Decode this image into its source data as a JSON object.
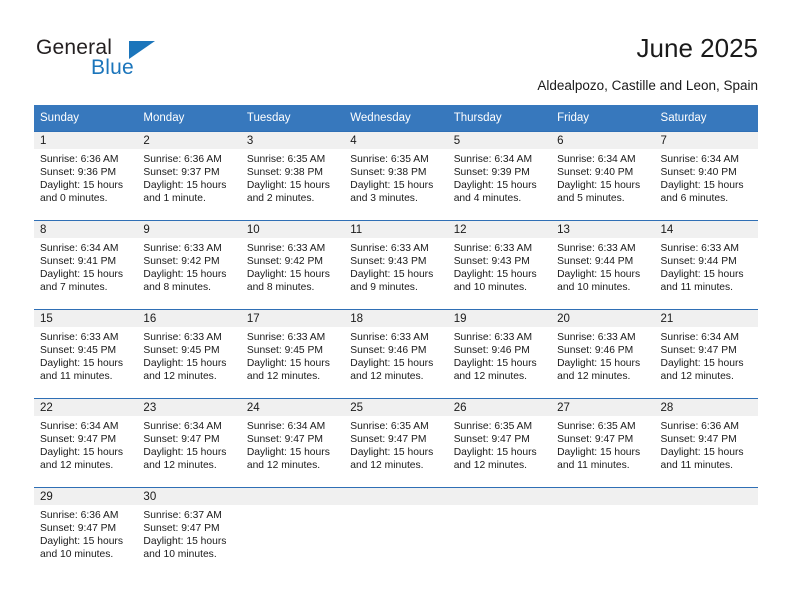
{
  "brand": {
    "name_part1": "General",
    "name_part2": "Blue",
    "accent_color": "#1b75bb",
    "triangle_icon": "triangle-icon"
  },
  "header": {
    "title": "June 2025",
    "location": "Aldealpozo, Castille and Leon, Spain"
  },
  "theme": {
    "header_blue": "#3778bd",
    "row_border_blue": "#2f6fb5",
    "daynum_band": "#f0f0f0",
    "text": "#1a1a1a"
  },
  "weekday_headers": [
    "Sunday",
    "Monday",
    "Tuesday",
    "Wednesday",
    "Thursday",
    "Friday",
    "Saturday"
  ],
  "weeks": [
    [
      {
        "day": "1",
        "sunrise": "Sunrise: 6:36 AM",
        "sunset": "Sunset: 9:36 PM",
        "daylight_line1": "Daylight: 15 hours",
        "daylight_line2": "and 0 minutes."
      },
      {
        "day": "2",
        "sunrise": "Sunrise: 6:36 AM",
        "sunset": "Sunset: 9:37 PM",
        "daylight_line1": "Daylight: 15 hours",
        "daylight_line2": "and 1 minute."
      },
      {
        "day": "3",
        "sunrise": "Sunrise: 6:35 AM",
        "sunset": "Sunset: 9:38 PM",
        "daylight_line1": "Daylight: 15 hours",
        "daylight_line2": "and 2 minutes."
      },
      {
        "day": "4",
        "sunrise": "Sunrise: 6:35 AM",
        "sunset": "Sunset: 9:38 PM",
        "daylight_line1": "Daylight: 15 hours",
        "daylight_line2": "and 3 minutes."
      },
      {
        "day": "5",
        "sunrise": "Sunrise: 6:34 AM",
        "sunset": "Sunset: 9:39 PM",
        "daylight_line1": "Daylight: 15 hours",
        "daylight_line2": "and 4 minutes."
      },
      {
        "day": "6",
        "sunrise": "Sunrise: 6:34 AM",
        "sunset": "Sunset: 9:40 PM",
        "daylight_line1": "Daylight: 15 hours",
        "daylight_line2": "and 5 minutes."
      },
      {
        "day": "7",
        "sunrise": "Sunrise: 6:34 AM",
        "sunset": "Sunset: 9:40 PM",
        "daylight_line1": "Daylight: 15 hours",
        "daylight_line2": "and 6 minutes."
      }
    ],
    [
      {
        "day": "8",
        "sunrise": "Sunrise: 6:34 AM",
        "sunset": "Sunset: 9:41 PM",
        "daylight_line1": "Daylight: 15 hours",
        "daylight_line2": "and 7 minutes."
      },
      {
        "day": "9",
        "sunrise": "Sunrise: 6:33 AM",
        "sunset": "Sunset: 9:42 PM",
        "daylight_line1": "Daylight: 15 hours",
        "daylight_line2": "and 8 minutes."
      },
      {
        "day": "10",
        "sunrise": "Sunrise: 6:33 AM",
        "sunset": "Sunset: 9:42 PM",
        "daylight_line1": "Daylight: 15 hours",
        "daylight_line2": "and 8 minutes."
      },
      {
        "day": "11",
        "sunrise": "Sunrise: 6:33 AM",
        "sunset": "Sunset: 9:43 PM",
        "daylight_line1": "Daylight: 15 hours",
        "daylight_line2": "and 9 minutes."
      },
      {
        "day": "12",
        "sunrise": "Sunrise: 6:33 AM",
        "sunset": "Sunset: 9:43 PM",
        "daylight_line1": "Daylight: 15 hours",
        "daylight_line2": "and 10 minutes."
      },
      {
        "day": "13",
        "sunrise": "Sunrise: 6:33 AM",
        "sunset": "Sunset: 9:44 PM",
        "daylight_line1": "Daylight: 15 hours",
        "daylight_line2": "and 10 minutes."
      },
      {
        "day": "14",
        "sunrise": "Sunrise: 6:33 AM",
        "sunset": "Sunset: 9:44 PM",
        "daylight_line1": "Daylight: 15 hours",
        "daylight_line2": "and 11 minutes."
      }
    ],
    [
      {
        "day": "15",
        "sunrise": "Sunrise: 6:33 AM",
        "sunset": "Sunset: 9:45 PM",
        "daylight_line1": "Daylight: 15 hours",
        "daylight_line2": "and 11 minutes."
      },
      {
        "day": "16",
        "sunrise": "Sunrise: 6:33 AM",
        "sunset": "Sunset: 9:45 PM",
        "daylight_line1": "Daylight: 15 hours",
        "daylight_line2": "and 12 minutes."
      },
      {
        "day": "17",
        "sunrise": "Sunrise: 6:33 AM",
        "sunset": "Sunset: 9:45 PM",
        "daylight_line1": "Daylight: 15 hours",
        "daylight_line2": "and 12 minutes."
      },
      {
        "day": "18",
        "sunrise": "Sunrise: 6:33 AM",
        "sunset": "Sunset: 9:46 PM",
        "daylight_line1": "Daylight: 15 hours",
        "daylight_line2": "and 12 minutes."
      },
      {
        "day": "19",
        "sunrise": "Sunrise: 6:33 AM",
        "sunset": "Sunset: 9:46 PM",
        "daylight_line1": "Daylight: 15 hours",
        "daylight_line2": "and 12 minutes."
      },
      {
        "day": "20",
        "sunrise": "Sunrise: 6:33 AM",
        "sunset": "Sunset: 9:46 PM",
        "daylight_line1": "Daylight: 15 hours",
        "daylight_line2": "and 12 minutes."
      },
      {
        "day": "21",
        "sunrise": "Sunrise: 6:34 AM",
        "sunset": "Sunset: 9:47 PM",
        "daylight_line1": "Daylight: 15 hours",
        "daylight_line2": "and 12 minutes."
      }
    ],
    [
      {
        "day": "22",
        "sunrise": "Sunrise: 6:34 AM",
        "sunset": "Sunset: 9:47 PM",
        "daylight_line1": "Daylight: 15 hours",
        "daylight_line2": "and 12 minutes."
      },
      {
        "day": "23",
        "sunrise": "Sunrise: 6:34 AM",
        "sunset": "Sunset: 9:47 PM",
        "daylight_line1": "Daylight: 15 hours",
        "daylight_line2": "and 12 minutes."
      },
      {
        "day": "24",
        "sunrise": "Sunrise: 6:34 AM",
        "sunset": "Sunset: 9:47 PM",
        "daylight_line1": "Daylight: 15 hours",
        "daylight_line2": "and 12 minutes."
      },
      {
        "day": "25",
        "sunrise": "Sunrise: 6:35 AM",
        "sunset": "Sunset: 9:47 PM",
        "daylight_line1": "Daylight: 15 hours",
        "daylight_line2": "and 12 minutes."
      },
      {
        "day": "26",
        "sunrise": "Sunrise: 6:35 AM",
        "sunset": "Sunset: 9:47 PM",
        "daylight_line1": "Daylight: 15 hours",
        "daylight_line2": "and 12 minutes."
      },
      {
        "day": "27",
        "sunrise": "Sunrise: 6:35 AM",
        "sunset": "Sunset: 9:47 PM",
        "daylight_line1": "Daylight: 15 hours",
        "daylight_line2": "and 11 minutes."
      },
      {
        "day": "28",
        "sunrise": "Sunrise: 6:36 AM",
        "sunset": "Sunset: 9:47 PM",
        "daylight_line1": "Daylight: 15 hours",
        "daylight_line2": "and 11 minutes."
      }
    ],
    [
      {
        "day": "29",
        "sunrise": "Sunrise: 6:36 AM",
        "sunset": "Sunset: 9:47 PM",
        "daylight_line1": "Daylight: 15 hours",
        "daylight_line2": "and 10 minutes."
      },
      {
        "day": "30",
        "sunrise": "Sunrise: 6:37 AM",
        "sunset": "Sunset: 9:47 PM",
        "daylight_line1": "Daylight: 15 hours",
        "daylight_line2": "and 10 minutes."
      },
      {
        "day": "",
        "sunrise": "",
        "sunset": "",
        "daylight_line1": "",
        "daylight_line2": ""
      },
      {
        "day": "",
        "sunrise": "",
        "sunset": "",
        "daylight_line1": "",
        "daylight_line2": ""
      },
      {
        "day": "",
        "sunrise": "",
        "sunset": "",
        "daylight_line1": "",
        "daylight_line2": ""
      },
      {
        "day": "",
        "sunrise": "",
        "sunset": "",
        "daylight_line1": "",
        "daylight_line2": ""
      },
      {
        "day": "",
        "sunrise": "",
        "sunset": "",
        "daylight_line1": "",
        "daylight_line2": ""
      }
    ]
  ]
}
